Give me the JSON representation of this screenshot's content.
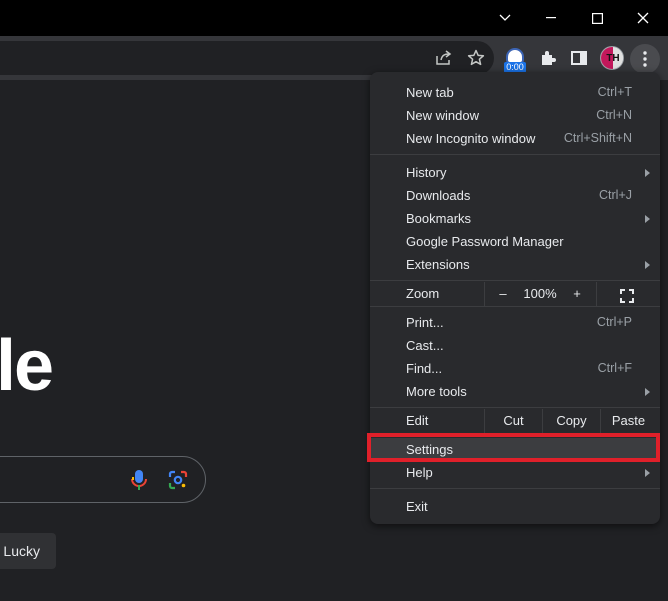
{
  "window_controls": {
    "icons": [
      "chevron-down-icon",
      "minimize-icon",
      "maximize-icon",
      "close-icon"
    ]
  },
  "toolbar": {
    "icons": [
      "share-icon",
      "bookmark-star-icon",
      "extensions-puzzle-icon",
      "side-panel-icon",
      "more-vert-icon"
    ],
    "extension_badge_text": "0:00",
    "avatar_initials": "TH"
  },
  "page": {
    "logo_fragment": "le",
    "lucky_button": "Lucky"
  },
  "menu": {
    "items": [
      {
        "label": "New tab",
        "shortcut": "Ctrl+T"
      },
      {
        "label": "New window",
        "shortcut": "Ctrl+N"
      },
      {
        "label": "New Incognito window",
        "shortcut": "Ctrl+Shift+N"
      },
      {
        "label": "History",
        "shortcut": ""
      },
      {
        "label": "Downloads",
        "shortcut": "Ctrl+J"
      },
      {
        "label": "Bookmarks",
        "shortcut": ""
      },
      {
        "label": "Google Password Manager",
        "shortcut": ""
      },
      {
        "label": "Extensions",
        "shortcut": ""
      },
      {
        "label": "Print...",
        "shortcut": "Ctrl+P"
      },
      {
        "label": "Cast...",
        "shortcut": ""
      },
      {
        "label": "Find...",
        "shortcut": "Ctrl+F"
      },
      {
        "label": "More tools",
        "shortcut": ""
      },
      {
        "label": "Settings",
        "shortcut": ""
      },
      {
        "label": "Help",
        "shortcut": ""
      },
      {
        "label": "Exit",
        "shortcut": ""
      }
    ],
    "zoom": {
      "label": "Zoom",
      "minus": "–",
      "value": "100%",
      "plus": "+"
    },
    "edit": {
      "label": "Edit",
      "cut": "Cut",
      "copy": "Copy",
      "paste": "Paste"
    }
  },
  "colors": {
    "highlight_border": "#e0202a",
    "menu_bg": "#292a2d",
    "page_bg": "#202124"
  }
}
